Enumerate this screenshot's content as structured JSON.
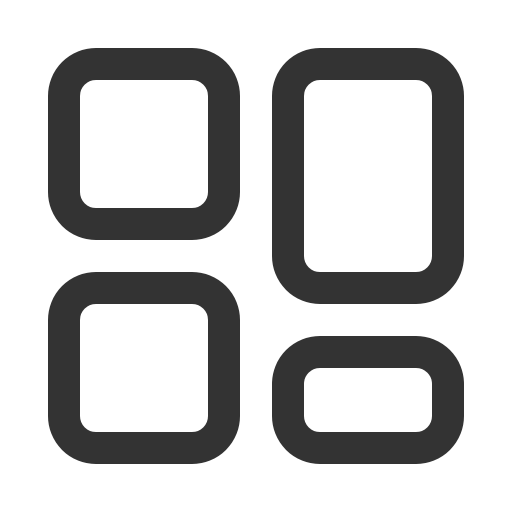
{
  "icon": {
    "name": "dashboard-layout-icon",
    "stroke_color": "#333333",
    "background_color": "#ffffff",
    "tiles": [
      "top-left-square",
      "top-right-tall-rectangle",
      "bottom-left-square",
      "bottom-right-short-rectangle"
    ]
  }
}
